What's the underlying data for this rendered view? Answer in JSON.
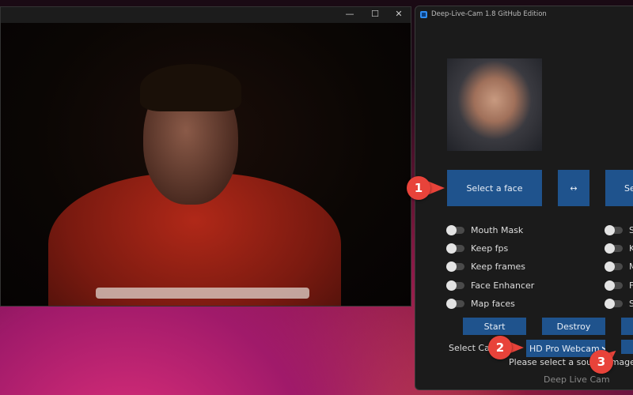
{
  "preview_window": {
    "controls": {
      "minimize": "—",
      "maximize": "☐",
      "close": "✕"
    }
  },
  "app": {
    "title": "Deep-Live-Cam 1.8 GitHub Edition",
    "footer": "Deep Live Cam"
  },
  "buttons": {
    "select_face": "Select a face",
    "swap": "↔",
    "select_target": "Se",
    "start": "Start",
    "destroy": "Destroy"
  },
  "switches_left": [
    {
      "label": "Mouth Mask",
      "on": false
    },
    {
      "label": "Keep fps",
      "on": false
    },
    {
      "label": "Keep frames",
      "on": false
    },
    {
      "label": "Face Enhancer",
      "on": false
    },
    {
      "label": "Map faces",
      "on": false
    }
  ],
  "switches_right": [
    {
      "label": "Sh",
      "on": false
    },
    {
      "label": "K",
      "on": false
    },
    {
      "label": "M",
      "on": false
    },
    {
      "label": "Fi",
      "on": false
    },
    {
      "label": "Sh",
      "on": false
    }
  ],
  "camera": {
    "label": "Select Cam",
    "selected": "HD Pro Webcam"
  },
  "status": "Please select a source image first",
  "callouts": [
    "1",
    "2",
    "3"
  ],
  "colors": {
    "button": "#1f538d",
    "callout": "#e8433a"
  }
}
